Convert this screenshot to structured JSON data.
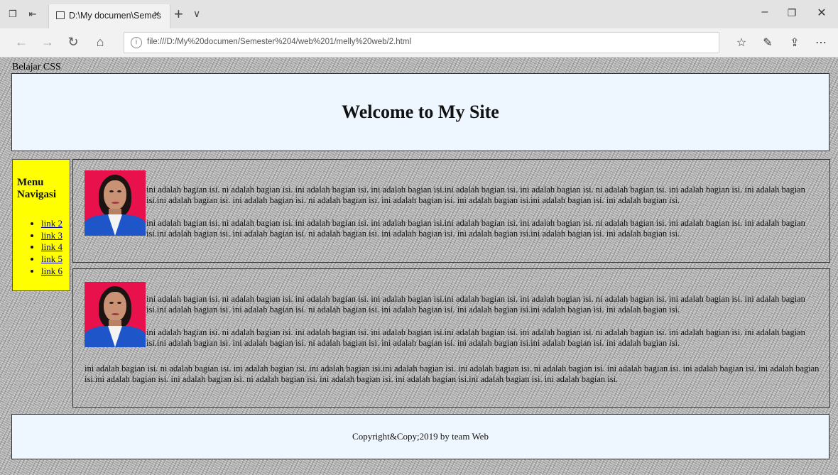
{
  "browser": {
    "tab_title": "D:\\My documen\\Semes",
    "url": "file:///D:/My%20documen/Semester%204/web%201/melly%20web/2.html"
  },
  "page": {
    "label": "Belajar CSS",
    "heading": "Welcome to My Site",
    "menu_title": "Menu Navigasi",
    "menu_links": [
      "link 2",
      "link 3",
      "link 4",
      "link 5",
      "link 6"
    ],
    "article1": {
      "p1": "ini adalah bagian isi. ni adalah bagian isi. ini adalah bagian isi. ini adalah bagian isi.ini adalah bagian isi. ini adalah bagian isi. ni adalah bagian isi. ini adalah bagian isi. ini adalah bagian isi.ini adalah bagian isi. ini adalah bagian isi. ni adalah bagian isi. ini adalah bagian isi. ini adalah bagian isi.ini adalah bagian isi. ini adalah bagian isi.",
      "p2": "ini adalah bagian isi. ni adalah bagian isi. ini adalah bagian isi. ini adalah bagian isi.ini adalah bagian isi. ini adalah bagian isi. ni adalah bagian isi. ini adalah bagian isi. ini adalah bagian isi.ini adalah bagian isi. ini adalah bagian isi. ni adalah bagian isi. ini adalah bagian isi. ini adalah bagian isi.ini adalah bagian isi. ini adalah bagian isi."
    },
    "article2": {
      "p1": "ini adalah bagian isi. ni adalah bagian isi. ini adalah bagian isi. ini adalah bagian isi.ini adalah bagian isi. ini adalah bagian isi. ni adalah bagian isi. ini adalah bagian isi. ini adalah bagian isi.ini adalah bagian isi. ini adalah bagian isi. ni adalah bagian isi. ini adalah bagian isi. ini adalah bagian isi.ini adalah bagian isi. ini adalah bagian isi.",
      "p2": "ini adalah bagian isi. ni adalah bagian isi. ini adalah bagian isi. ini adalah bagian isi.ini adalah bagian isi. ini adalah bagian isi. ni adalah bagian isi. ini adalah bagian isi. ini adalah bagian isi.ini adalah bagian isi. ini adalah bagian isi. ni adalah bagian isi. ini adalah bagian isi. ini adalah bagian isi.ini adalah bagian isi. ini adalah bagian isi.",
      "p3": "ini adalah bagian isi. ni adalah bagian isi. ini adalah bagian isi. ini adalah bagian isi.ini adalah bagian isi. ini adalah bagian isi. ni adalah bagian isi. ini adalah bagian isi. ini adalah bagian isi. ini adalah bagian isi.ini adalah bagian isi. ini adalah bagian isi. ni adalah bagian isi. ini adalah bagian isi. ini adalah bagian isi.ini adalah bagian isi. ini adalah bagian isi."
    },
    "footer": "Copyright&Copy;2019 by team Web"
  }
}
